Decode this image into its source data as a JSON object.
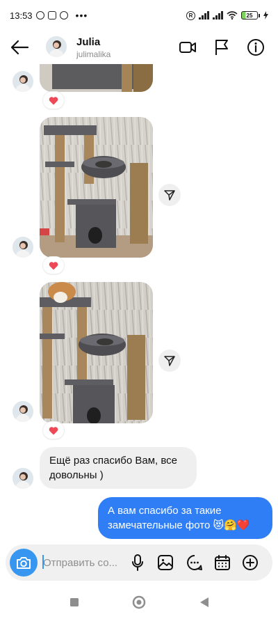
{
  "status_bar": {
    "time": "13:53",
    "roaming_label": "R",
    "battery_level": "25"
  },
  "header": {
    "name": "Julia",
    "username": "julimalika"
  },
  "messages": [
    {
      "type": "photo",
      "reaction": "heart"
    },
    {
      "type": "photo",
      "reaction": "heart"
    },
    {
      "type": "photo",
      "reaction": "heart"
    },
    {
      "type": "text",
      "direction": "incoming",
      "text": "Ещё раз спасибо Вам, все довольны )"
    },
    {
      "type": "text",
      "direction": "outgoing",
      "text": "А вам спасибо за такие замечательные фото 😻🤗❤️"
    }
  ],
  "composer": {
    "placeholder": "Отправить со..."
  },
  "colors": {
    "accent": "#3797f0",
    "outgoing_bubble": "#2f7ef6",
    "incoming_bubble": "#efefef",
    "heart": "#ed4956"
  }
}
